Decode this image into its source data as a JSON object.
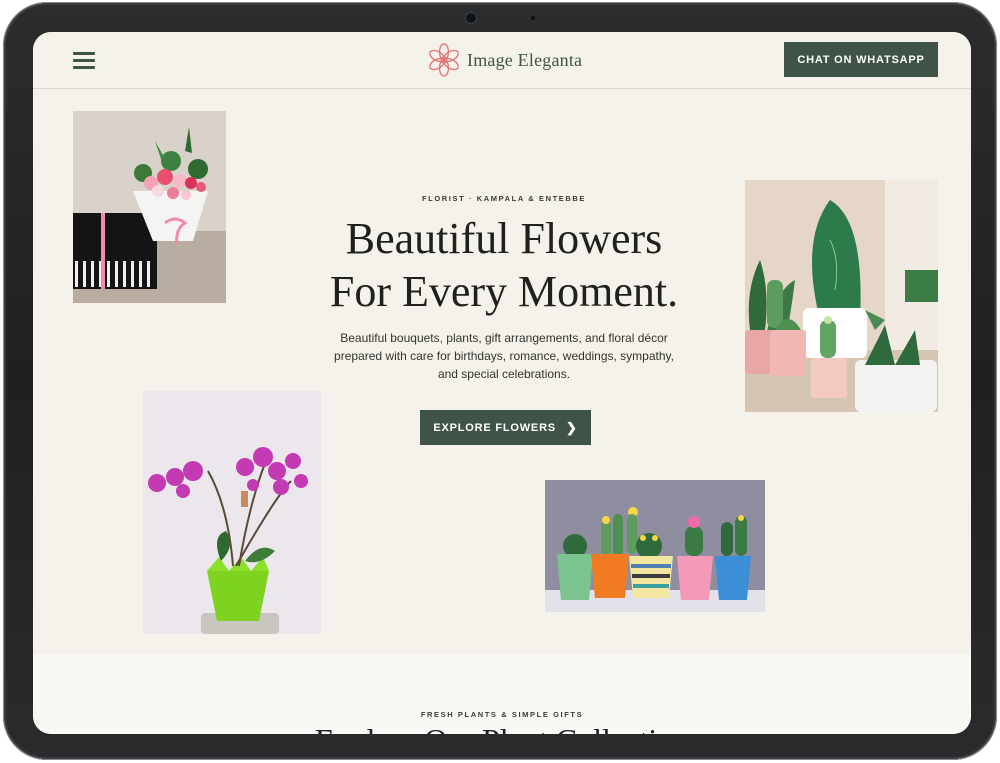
{
  "brand": {
    "name": "Image Eleganta",
    "accent": "#3f5446",
    "logo_color": "#e07a7a"
  },
  "header": {
    "menu_icon": "hamburger-menu-icon",
    "whatsapp_label": "CHAT ON WHATSAPP"
  },
  "hero": {
    "eyebrow": "FLORIST · KAMPALA & ENTEBBE",
    "headline_line1": "Beautiful Flowers",
    "headline_line2": "For Every Moment.",
    "subtext": "Beautiful bouquets, plants, gift arrangements, and floral décor prepared with care for birthdays, romance, weddings, sympathy, and special celebrations.",
    "cta_label": "EXPLORE FLOWERS",
    "cta_icon": "chevron-right-icon"
  },
  "section2": {
    "eyebrow": "FRESH PLANTS & SIMPLE GIFTS",
    "title": "Explore Our Plant Collection"
  }
}
